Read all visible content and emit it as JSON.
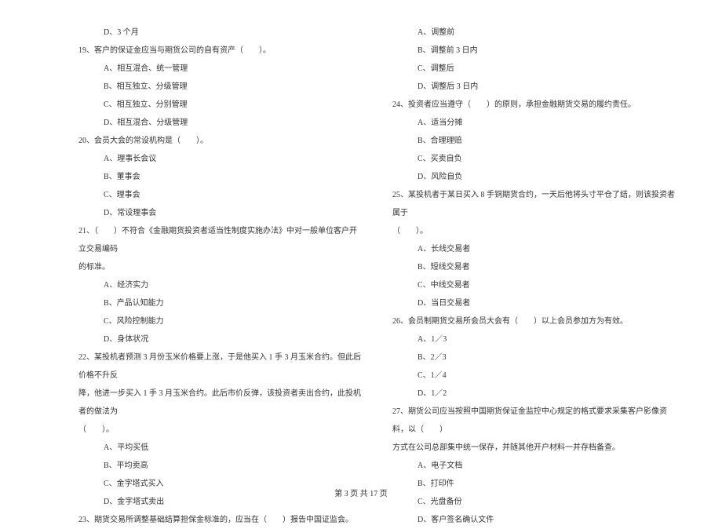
{
  "left_column": {
    "items": [
      {
        "type": "option",
        "text": "D、3 个月"
      },
      {
        "type": "question",
        "text": "19、客户的保证金应当与期货公司的自有资产（　　）。"
      },
      {
        "type": "option",
        "text": "A、相互混合、统一管理"
      },
      {
        "type": "option",
        "text": "B、相互独立、分级管理"
      },
      {
        "type": "option",
        "text": "C、相互独立、分别管理"
      },
      {
        "type": "option",
        "text": "D、相互混合、分级管理"
      },
      {
        "type": "question",
        "text": "20、会员大会的常设机构是（　　）。"
      },
      {
        "type": "option",
        "text": "A、理事长会议"
      },
      {
        "type": "option",
        "text": "B、董事会"
      },
      {
        "type": "option",
        "text": "C、理事会"
      },
      {
        "type": "option",
        "text": "D、常设理事会"
      },
      {
        "type": "question",
        "text": "21、（　　）不符合《金融期货投资者适当性制度实施办法》中对一般单位客户开立交易编码"
      },
      {
        "type": "question-cont",
        "text": "的标准。"
      },
      {
        "type": "option",
        "text": "A、经济实力"
      },
      {
        "type": "option",
        "text": "B、产品认知能力"
      },
      {
        "type": "option",
        "text": "C、风险控制能力"
      },
      {
        "type": "option",
        "text": "D、身体状况"
      },
      {
        "type": "question",
        "text": "22、某投机者预测 3 月份玉米价格要上涨，于是他买入 1 手 3 月玉米合约。但此后价格不升反"
      },
      {
        "type": "question-cont",
        "text": "降，他进一步买入 1 手 3 月玉米合约。此后市价反弹，该投资者卖出合约，此投机者的做法为"
      },
      {
        "type": "question-cont",
        "text": "（　　）。"
      },
      {
        "type": "option",
        "text": "A、平均买低"
      },
      {
        "type": "option",
        "text": "B、平均卖高"
      },
      {
        "type": "option",
        "text": "C、金字塔式买入"
      },
      {
        "type": "option",
        "text": "D、金字塔式卖出"
      },
      {
        "type": "question",
        "text": "23、期货交易所调整基础结算担保金标准的，应当在（　　）报告中国证监会。"
      }
    ]
  },
  "right_column": {
    "items": [
      {
        "type": "option",
        "text": "A、调整前"
      },
      {
        "type": "option",
        "text": "B、调整前 3 日内"
      },
      {
        "type": "option",
        "text": "C、调整后"
      },
      {
        "type": "option",
        "text": "D、调整后 3 日内"
      },
      {
        "type": "question",
        "text": "24、投资者应当遵守（　　）的原则，承担金融期货交易的履约责任。"
      },
      {
        "type": "option",
        "text": "A、适当分摊"
      },
      {
        "type": "option",
        "text": "B、合理理赔"
      },
      {
        "type": "option",
        "text": "C、买卖自负"
      },
      {
        "type": "option",
        "text": "D、风险自负"
      },
      {
        "type": "question",
        "text": "25、某投机者于某日买入 8 手铜期货合约，一天后他将头寸平仓了结，则该投资者属于"
      },
      {
        "type": "question-cont",
        "text": "（　　）。"
      },
      {
        "type": "option",
        "text": "A、长线交易者"
      },
      {
        "type": "option",
        "text": "B、短线交易者"
      },
      {
        "type": "option",
        "text": "C、中线交易者"
      },
      {
        "type": "option",
        "text": "D、当日交易者"
      },
      {
        "type": "question",
        "text": "26、会员制期货交易所会员大会有（　　）以上会员参加方为有效。"
      },
      {
        "type": "option",
        "text": "A、1／3"
      },
      {
        "type": "option",
        "text": "B、2／3"
      },
      {
        "type": "option",
        "text": "C、1／4"
      },
      {
        "type": "option",
        "text": "D、1／2"
      },
      {
        "type": "question",
        "text": "27、期货公司应当按照中国期货保证金监控中心规定的格式要求采集客户影像资料，以（　　）"
      },
      {
        "type": "question-cont",
        "text": "方式在公司总部集中统一保存，并随其他开户材料一并存档备查。"
      },
      {
        "type": "option",
        "text": "A、电子文档"
      },
      {
        "type": "option",
        "text": "B、打印件"
      },
      {
        "type": "option",
        "text": "C、光盘备份"
      },
      {
        "type": "option",
        "text": "D、客户签名确认文件"
      }
    ]
  },
  "footer": {
    "text": "第 3 页 共 17 页"
  }
}
